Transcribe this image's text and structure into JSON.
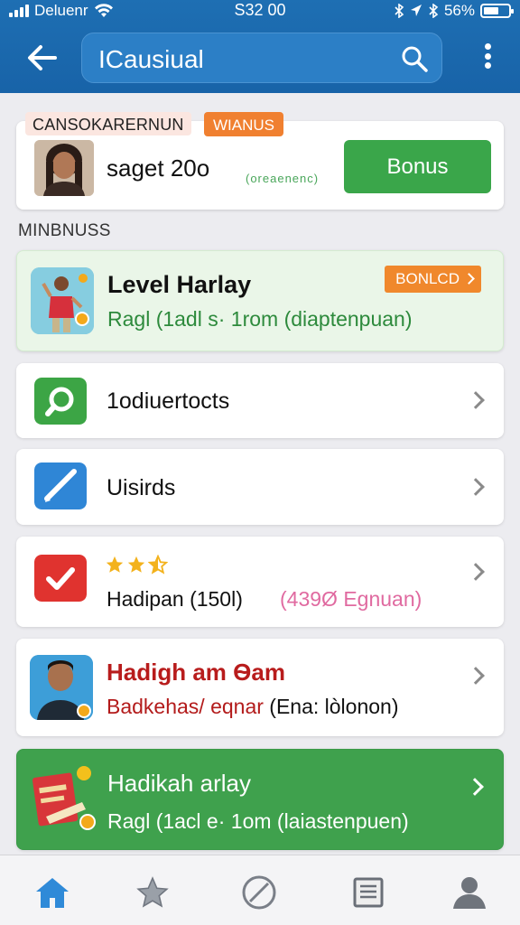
{
  "status_bar": {
    "carrier": "Deluenr",
    "time": "S32 00",
    "battery": "56%"
  },
  "header": {
    "search_value": "ICausiual"
  },
  "casual_card": {
    "label": "CANSOKARERNUN",
    "badge": "WIANUS",
    "name": "saget 20o",
    "code": "(oreaenenc)",
    "bonus_button": "Bonus"
  },
  "section_title": "MINBNUSS",
  "level_card": {
    "title": "Level Harlay",
    "subtitle": "Ragl (1adl s· 1rom (diaptenpuan)",
    "tag": "BONLCD"
  },
  "list": {
    "tutorials_label": "1odiuertocts",
    "visits_label": "Uisirds"
  },
  "rating_card": {
    "stars": 3,
    "text": "Hadipan (150l)",
    "note": "(439Ø Egnuan)"
  },
  "highlight_card": {
    "title": "Hadigh am Ѳam",
    "subtitle_accent": "Badkehas/ eqnar",
    "subtitle_rest": "(Ena: lòlonon)"
  },
  "green_card": {
    "title": "Hadikah arlay",
    "subtitle": "Ragl (1acl e· 1om (laiastenpuen)"
  },
  "colors": {
    "header_blue": "#1e6fb3",
    "accent_green": "#3aa64a",
    "accent_orange": "#f08030",
    "highlight_red": "#b81c1c"
  },
  "icons": {
    "nav": [
      "home-icon",
      "star-icon",
      "compass-icon",
      "document-icon",
      "profile-icon"
    ]
  }
}
